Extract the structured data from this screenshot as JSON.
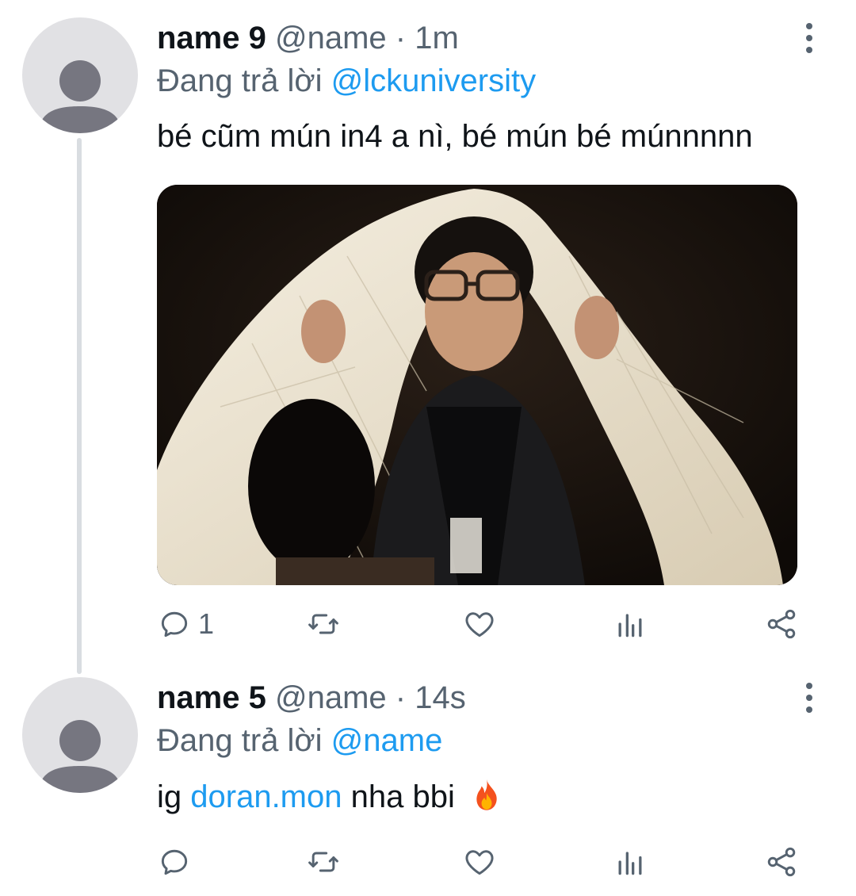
{
  "tweets": [
    {
      "name": "name 9",
      "handle": "@name",
      "separator": "·",
      "time": "1m",
      "reply_prefix": "Đang trả lời",
      "reply_to": "@lckuniversity",
      "text": "bé cũm mún in4 a nì, bé mún bé múnnnnn",
      "reply_count": "1"
    },
    {
      "name": "name 5",
      "handle": "@name",
      "separator": "·",
      "time": "14s",
      "reply_prefix": "Đang trả lời",
      "reply_to": "@name",
      "text_prefix": "ig",
      "text_link": "doran.mon",
      "text_suffix": "nha bbi",
      "emoji": "fire-emoji"
    }
  ],
  "icons": {
    "reply": "reply-icon",
    "retweet": "retweet-icon",
    "like": "heart-icon",
    "views": "analytics-icon",
    "share": "share-icon",
    "more": "more-vertical-icon",
    "avatar": "default-avatar-icon"
  },
  "colors": {
    "link": "#1d9bf0",
    "secondary_text": "#566370",
    "primary_text": "#0f1419",
    "thread_line": "#d9dde1",
    "avatar_bg": "#e1e1e4",
    "avatar_fg": "#767680"
  }
}
